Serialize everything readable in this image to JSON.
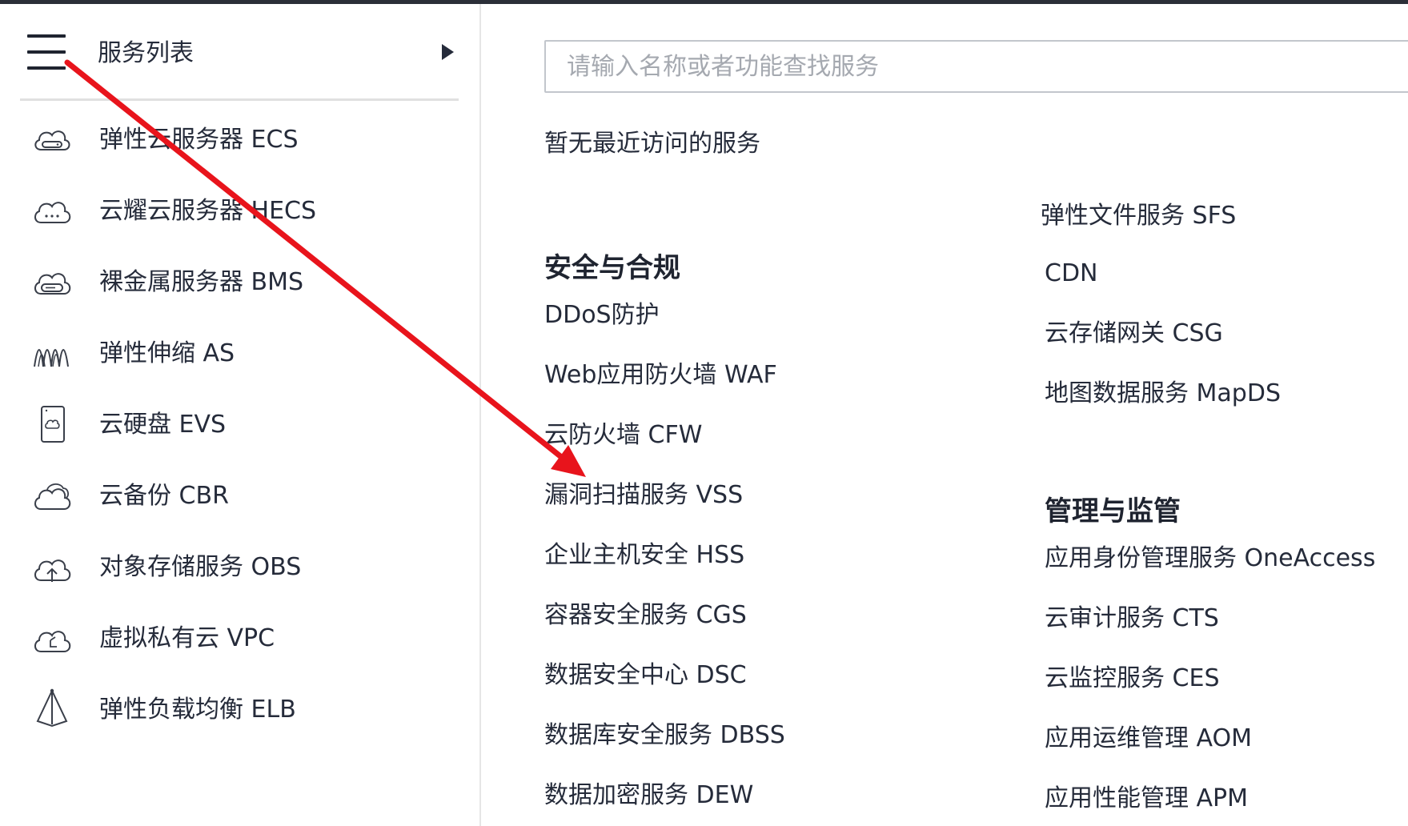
{
  "sidebar": {
    "title": "服务列表",
    "items": [
      {
        "label": "弹性云服务器 ECS",
        "icon": "cloud-server-icon"
      },
      {
        "label": "云耀云服务器 HECS",
        "icon": "cloud-dots-icon"
      },
      {
        "label": "裸金属服务器 BMS",
        "icon": "bare-metal-server-icon"
      },
      {
        "label": "弹性伸缩 AS",
        "icon": "auto-scaling-icon"
      },
      {
        "label": "云硬盘 EVS",
        "icon": "cloud-disk-icon"
      },
      {
        "label": "云备份 CBR",
        "icon": "cloud-backup-icon"
      },
      {
        "label": "对象存储服务 OBS",
        "icon": "cloud-upload-icon"
      },
      {
        "label": "虚拟私有云 VPC",
        "icon": "cloud-network-icon"
      },
      {
        "label": "弹性负载均衡 ELB",
        "icon": "load-balancer-icon"
      }
    ]
  },
  "search": {
    "placeholder": "请输入名称或者功能查找服务",
    "value": ""
  },
  "recent_text": "暂无最近访问的服务",
  "col1": {
    "category": "安全与合规",
    "services": [
      "DDoS防护",
      "Web应用防火墙 WAF",
      "云防火墙 CFW",
      "漏洞扫描服务 VSS",
      "企业主机安全 HSS",
      "容器安全服务 CGS",
      "数据安全中心 DSC",
      "数据库安全服务 DBSS",
      "数据加密服务 DEW"
    ]
  },
  "col2": {
    "partial_item": "弹性文件服务 SFS",
    "services_top": [
      "CDN",
      "云存储网关 CSG",
      "地图数据服务 MapDS"
    ],
    "category": "管理与监管",
    "services": [
      "应用身份管理服务 OneAccess",
      "云审计服务 CTS",
      "云监控服务 CES",
      "应用运维管理 AOM",
      "应用性能管理 APM"
    ]
  },
  "colors": {
    "annotation_arrow": "#e8141c",
    "topbar": "#2b2f38",
    "text": "#252b3a"
  }
}
